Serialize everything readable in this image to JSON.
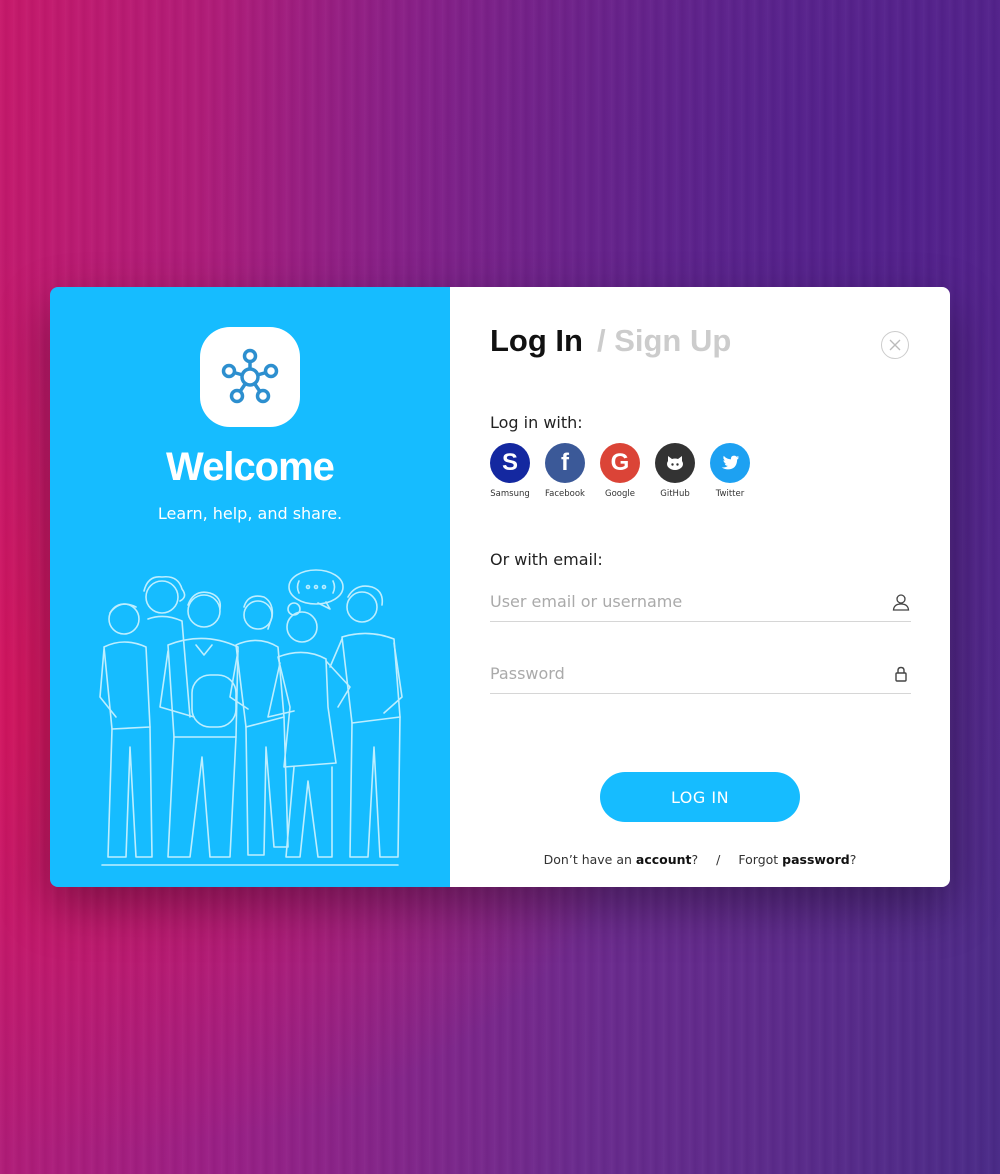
{
  "left": {
    "welcome": "Welcome",
    "tagline": "Learn, help, and share."
  },
  "header": {
    "login_tab": "Log In",
    "signup_tab": "/ Sign Up"
  },
  "social": {
    "label": "Log in with:",
    "providers": [
      {
        "name": "Samsung",
        "color": "#1428a0",
        "icon": "samsung-icon"
      },
      {
        "name": "Facebook",
        "color": "#3b5998",
        "icon": "facebook-icon"
      },
      {
        "name": "Google",
        "color": "#db4437",
        "icon": "google-icon"
      },
      {
        "name": "GitHub",
        "color": "#333333",
        "icon": "github-icon"
      },
      {
        "name": "Twitter",
        "color": "#1da1f2",
        "icon": "twitter-icon"
      }
    ]
  },
  "email": {
    "label": "Or with email:",
    "username_placeholder": "User email or username",
    "password_placeholder": "Password"
  },
  "actions": {
    "login_button": "LOG IN"
  },
  "footer": {
    "no_account_prefix": "Don’t have an ",
    "no_account_link": "account",
    "no_account_suffix": "?",
    "separator": "/",
    "forgot_prefix": "Forgot ",
    "forgot_link": "password",
    "forgot_suffix": "?"
  },
  "colors": {
    "accent": "#16bcff",
    "muted_tab": "#cccccc"
  }
}
